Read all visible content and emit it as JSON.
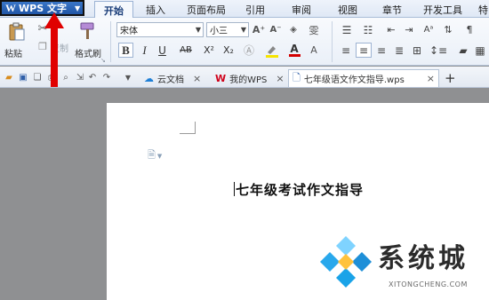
{
  "menubar": {
    "app_button": {
      "label": "WPS 文字",
      "logo": "W"
    },
    "tabs": [
      "开始",
      "插入",
      "页面布局",
      "引用",
      "审阅",
      "视图",
      "章节",
      "开发工具",
      "特"
    ],
    "active_tab": "开始"
  },
  "ribbon": {
    "clipboard": {
      "paste": "粘贴",
      "cut": "剪切",
      "copy": "复制",
      "format_painter": "格式刷"
    },
    "font": {
      "family": "宋体",
      "size": "小三"
    },
    "format_buttons": {
      "bold": "B",
      "italic": "I",
      "underline": "U",
      "strike": "AB",
      "superscript": "X²",
      "subscript": "X₂",
      "font_color": "A"
    }
  },
  "tabbar": {
    "tabs": [
      {
        "label": "云文档",
        "icon": "cloud-doc-icon"
      },
      {
        "label": "我的WPS",
        "icon": "wps-logo-icon"
      },
      {
        "label": "七年级语文作文指导.wps",
        "icon": "document-icon"
      }
    ],
    "add_tab": "+"
  },
  "document": {
    "title": "七年级考试作文指导"
  },
  "watermark": {
    "text": "系统城",
    "url": "XITONGCHENG.COM"
  },
  "colors": {
    "app_button": "#2a63b5",
    "annotation_arrow": "#e00000",
    "watermark_blue": "#1aa3e8"
  }
}
